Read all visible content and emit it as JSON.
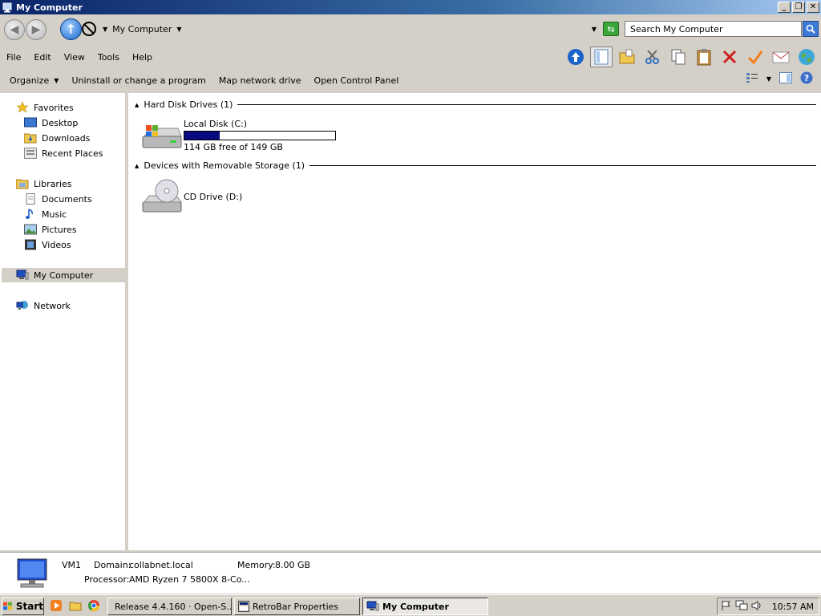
{
  "window": {
    "title": "My Computer"
  },
  "address": {
    "path": "My Computer",
    "search_placeholder": "Search My Computer"
  },
  "menu": [
    "File",
    "Edit",
    "View",
    "Tools",
    "Help"
  ],
  "commands": {
    "organize": "Organize",
    "uninstall": "Uninstall or change a program",
    "map_drive": "Map network drive",
    "control_panel": "Open Control Panel"
  },
  "nav": {
    "favorites": "Favorites",
    "desktop": "Desktop",
    "downloads": "Downloads",
    "recent": "Recent Places",
    "libraries": "Libraries",
    "documents": "Documents",
    "music": "Music",
    "pictures": "Pictures",
    "videos": "Videos",
    "my_computer": "My Computer",
    "network": "Network"
  },
  "groups": {
    "hdd": "Hard Disk Drives (1)",
    "removable": "Devices with Removable Storage (1)"
  },
  "drives": {
    "c_name": "Local Disk (C:)",
    "c_free": "114 GB free of 149 GB",
    "c_used_fraction": 0.235,
    "d_name": "CD Drive (D:)"
  },
  "details": {
    "name": "VM1",
    "domain_label": "Domain:",
    "domain_value": "collabnet.local",
    "memory_label": "Memory:",
    "memory_value": "8.00 GB",
    "processor_label": "Processor:",
    "processor_value": "AMD Ryzen 7 5800X 8-Co..."
  },
  "taskbar": {
    "start": "Start",
    "task1": "Release 4.4.160 · Open-S...",
    "task2": "RetroBar Properties",
    "task3": "My Computer",
    "clock": "10:57 AM"
  },
  "colors": {
    "titlebar": "#0a246a",
    "capacity_fill": "#0a0a80",
    "chrome": "#d4d0c8"
  }
}
